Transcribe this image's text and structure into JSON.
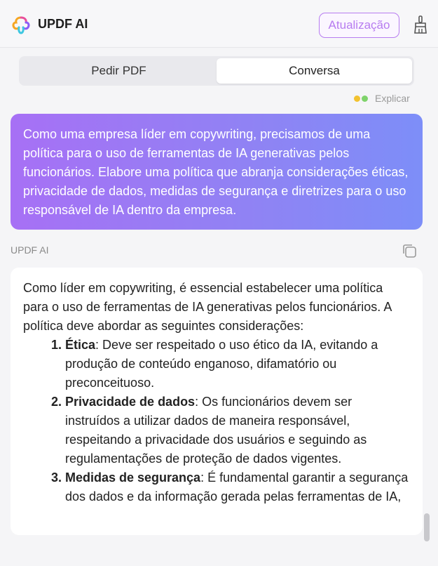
{
  "header": {
    "app_name": "UPDF AI",
    "upgrade_label": "Atualização",
    "logo_icon": "updf-logo-icon",
    "clean_icon": "broom-icon"
  },
  "tabs": [
    {
      "label": "Pedir PDF",
      "active": false
    },
    {
      "label": "Conversa",
      "active": true
    }
  ],
  "explain": {
    "label": "Explicar"
  },
  "user_message": {
    "text": "Como uma empresa líder em copywriting, precisamos de uma política para o uso de ferramentas de IA generativas pelos funcionários. Elabore uma política que abranja considerações éticas, privacidade de dados, medidas de segurança e diretrizes para o uso responsável de IA dentro da empresa."
  },
  "ai_response": {
    "sender_label": "UPDF AI",
    "copy_icon": "copy-icon",
    "intro": "Como líder em copywriting, é essencial estabelecer uma política para o uso de ferramentas de IA generativas pelos funcionários. A política deve abordar as seguintes considerações:",
    "items": [
      {
        "title": "Ética",
        "text": ": Deve ser respeitado o uso ético da IA, evitando a produção de conteúdo enganoso, difamatório ou preconceituoso."
      },
      {
        "title": "Privacidade de dados",
        "text": ": Os funcionários devem ser instruídos a utilizar dados de maneira responsável, respeitando a privacidade dos usuários e seguindo as regulamentações de proteção de dados vigentes."
      },
      {
        "title": "Medidas de segurança",
        "text": ": É fundamental garantir a segurança dos dados e da informação gerada pelas ferramentas de IA,"
      }
    ]
  },
  "colors": {
    "accent": "#b77cf0",
    "bubble_start": "#a770f5",
    "bubble_end": "#7d8ef8"
  }
}
